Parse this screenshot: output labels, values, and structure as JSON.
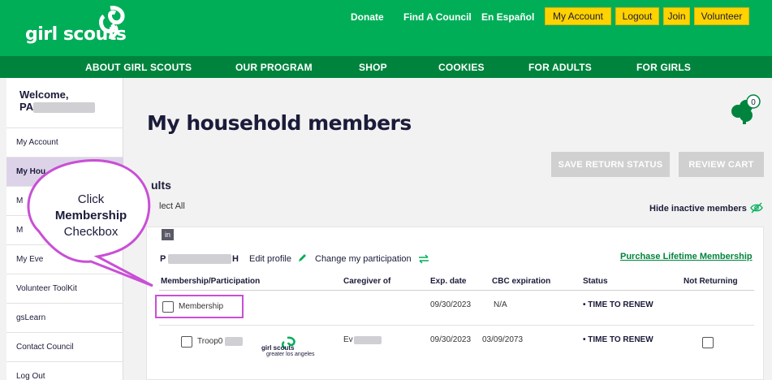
{
  "header": {
    "logo_text": "girl scouts",
    "links": {
      "donate": "Donate",
      "find_council": "Find A Council",
      "espanol": "En Español"
    },
    "buttons": {
      "account": "My Account",
      "logout": "Logout",
      "join": "Join",
      "volunteer": "Volunteer"
    },
    "nav": [
      "ABOUT GIRL SCOUTS",
      "OUR PROGRAM",
      "SHOP",
      "COOKIES",
      "FOR ADULTS",
      "FOR GIRLS"
    ],
    "colors": {
      "brand_green": "#00ae58",
      "nav_green": "#00843d",
      "button_yellow": "#ffd200"
    }
  },
  "sidebar": {
    "welcome": "Welcome,",
    "welcome_name_prefix": "PA",
    "items": [
      {
        "label": "My Account",
        "active": false
      },
      {
        "label": "My Hou",
        "active": true
      },
      {
        "label": "M",
        "active": false
      },
      {
        "label": "M",
        "active": false
      },
      {
        "label": "My Eve",
        "active": false
      },
      {
        "label": "Volunteer ToolKit",
        "active": false
      },
      {
        "label": "gsLearn",
        "active": false
      },
      {
        "label": "Contact Council",
        "active": false
      },
      {
        "label": "Log Out",
        "active": false
      }
    ]
  },
  "main": {
    "title": "My household members",
    "cart_count": "0",
    "save_return_status": "SAVE RETURN STATUS",
    "review_cart": "REVIEW CART",
    "section_title": "ults",
    "select_all": "lect All",
    "hide_inactive": "Hide inactive members",
    "tag": "in",
    "person": {
      "name_prefix": "P",
      "name_suffix": "H",
      "edit_profile": "Edit profile",
      "change_participation": "Change my participation",
      "purchase": "Purchase Lifetime Membership"
    },
    "columns": [
      "Membership/Participation",
      "Caregiver of",
      "Exp. date",
      "CBC expiration",
      "Status",
      "Not Returning"
    ],
    "rows": [
      {
        "name": "Membership",
        "caregiver": "",
        "exp": "09/30/2023",
        "cbc": "N/A",
        "status": "• TIME TO RENEW"
      },
      {
        "name": "Troop0",
        "caregiver": "Ev",
        "exp": "09/30/2023",
        "cbc": "03/09/2073",
        "status": "• TIME TO RENEW",
        "council_logo_line1": "girl scouts",
        "council_logo_line2": "greater los angeles"
      }
    ]
  },
  "callout": {
    "line1": "Click",
    "line2": "Membership",
    "line3": "Checkbox",
    "border_color": "#c94fd6"
  }
}
